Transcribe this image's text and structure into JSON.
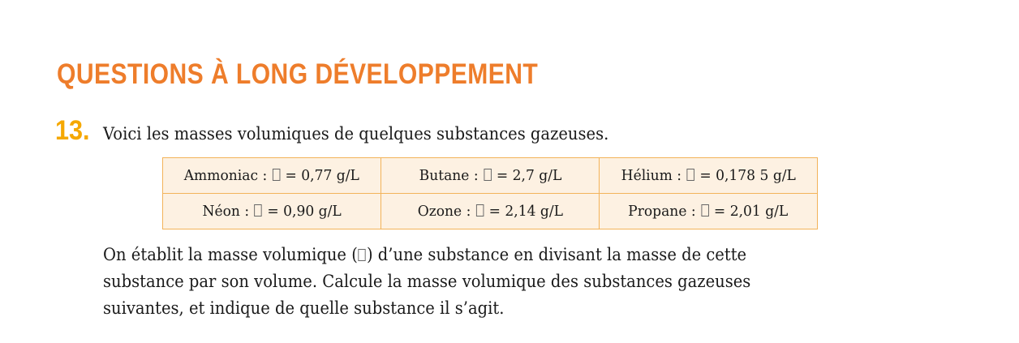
{
  "section_title": "QUESTIONS À LONG DÉVELOPPEMENT",
  "question": {
    "number": "13.",
    "intro": "Voici les masses volumiques de quelques substances gazeuses."
  },
  "substances": [
    {
      "name": "Ammoniac",
      "value": "0,77 g/L"
    },
    {
      "name": "Butane",
      "value": "2,7 g/L"
    },
    {
      "name": "Hélium",
      "value": "0,178 5 g/L"
    },
    {
      "name": "Néon",
      "value": "0,90 g/L"
    },
    {
      "name": "Ozone",
      "value": "2,14 g/L"
    },
    {
      "name": "Propane",
      "value": "2,01 g/L"
    }
  ],
  "labels": {
    "separator": " : ",
    "equals": " = "
  },
  "body": {
    "line1_before": "On établit la masse volumique (",
    "line1_after": ") d’une substance en divisant la masse de cette",
    "line2": "substance par son volume. Calcule la masse volumique des substances gazeuses",
    "line3": "suivantes, et indique de quelle substance il s’agit."
  }
}
